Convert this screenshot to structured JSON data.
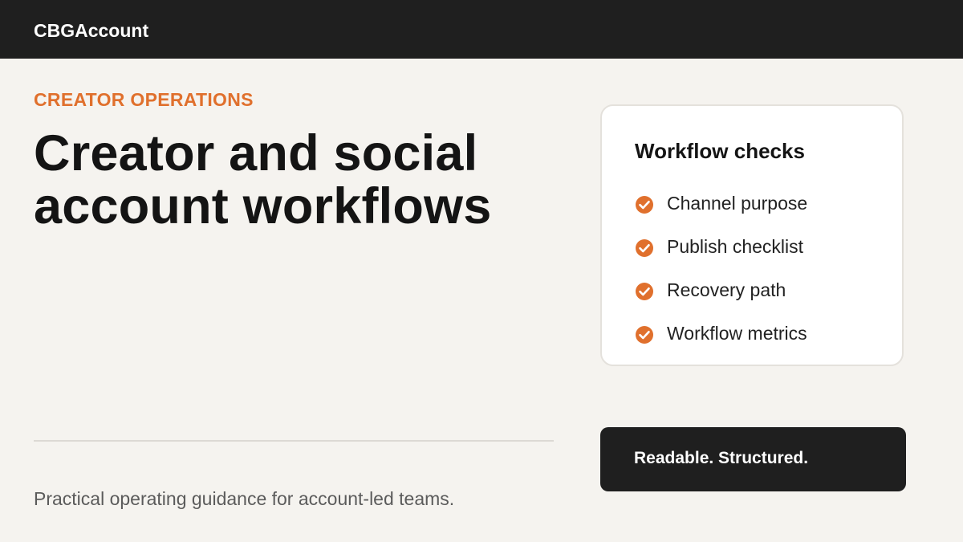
{
  "header": {
    "brand": "CBGAccount"
  },
  "hero": {
    "eyebrow": "CREATOR OPERATIONS",
    "title_line_1": "Creator and social",
    "title_line_2": "account workflows",
    "tagline": "Practical operating guidance for account-led teams."
  },
  "checks_card": {
    "title": "Workflow checks",
    "items": [
      {
        "label": "Channel purpose",
        "icon": "check-circle-icon"
      },
      {
        "label": "Publish checklist",
        "icon": "check-circle-icon"
      },
      {
        "label": "Recovery path",
        "icon": "check-circle-icon"
      },
      {
        "label": "Workflow metrics",
        "icon": "check-circle-icon"
      }
    ]
  },
  "banner": {
    "text": "Readable. Structured."
  },
  "colors": {
    "accent": "#e0702d",
    "dark": "#1f1f1f",
    "background": "#f5f3ef"
  }
}
